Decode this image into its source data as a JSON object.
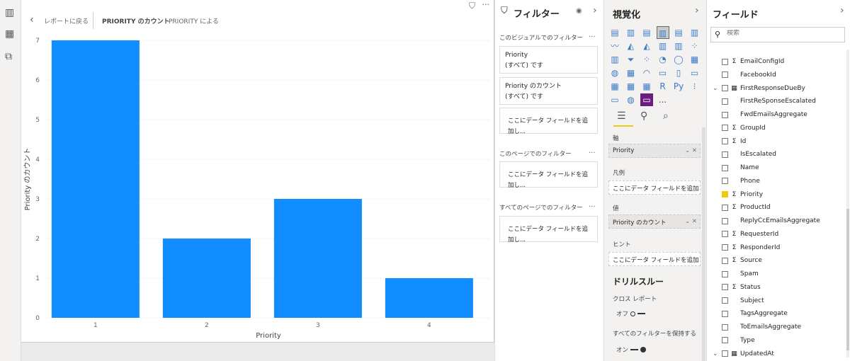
{
  "nav": {
    "icons": [
      "report-icon",
      "data-icon",
      "model-icon"
    ]
  },
  "header": {
    "back": "レポートに戻る",
    "tab1": "PRIORITY のカウント",
    "tab2": "PRIORITY による"
  },
  "chart_data": {
    "type": "bar",
    "categories": [
      "1",
      "2",
      "3",
      "4"
    ],
    "values": [
      7,
      2,
      3,
      1
    ],
    "xlabel": "Priority",
    "ylabel": "Priority のカウント",
    "ylim": [
      0,
      7
    ],
    "yticks": [
      0,
      1,
      2,
      3,
      4,
      5,
      6,
      7
    ],
    "color": "#118dff",
    "grid": true
  },
  "filters": {
    "title": "フィルター",
    "visual_section": "このビジュアルでのフィルター",
    "cards": [
      {
        "name": "Priority",
        "value": "(すべて) です"
      },
      {
        "name": "Priority のカウント",
        "value": "(すべて) です"
      }
    ],
    "add": "ここにデータ フィールドを追加し...",
    "page_section": "このページでのフィルター",
    "all_section": "すべてのページでのフィルター",
    "more": "..."
  },
  "viz": {
    "title": "視覚化",
    "axis_label": "軸",
    "axis_value": "Priority",
    "legend_label": "凡例",
    "add": "ここにデータ フィールドを追加して...",
    "values_label": "値",
    "values_value": "Priority のカウント",
    "tooltip_label": "ヒント",
    "drill_title": "ドリルスルー",
    "cross_report": "クロス レポート",
    "off": "オフ",
    "keep_filters": "すべてのフィルターを保持する",
    "on": "オン",
    "more": "..."
  },
  "fields": {
    "title": "フィールド",
    "search_placeholder": "検索",
    "items": [
      {
        "name": "EmailConfigId",
        "sigma": true
      },
      {
        "name": "FacebookId",
        "sigma": false
      },
      {
        "name": "FirstResponseDueBy",
        "table": true
      },
      {
        "name": "FirstReSponseEscalated",
        "sigma": false
      },
      {
        "name": "FwdEmailsAggregate",
        "sigma": false
      },
      {
        "name": "GroupId",
        "sigma": true
      },
      {
        "name": "Id",
        "sigma": true
      },
      {
        "name": "IsEscalated",
        "sigma": false
      },
      {
        "name": "Name",
        "sigma": false
      },
      {
        "name": "Phone",
        "sigma": false
      },
      {
        "name": "Priority",
        "sigma": true,
        "checked": true
      },
      {
        "name": "ProductId",
        "sigma": true
      },
      {
        "name": "ReplyCcEmailsAggregate",
        "sigma": false
      },
      {
        "name": "RequesterId",
        "sigma": true
      },
      {
        "name": "ResponderId",
        "sigma": true
      },
      {
        "name": "Source",
        "sigma": true
      },
      {
        "name": "Spam",
        "sigma": false
      },
      {
        "name": "Status",
        "sigma": true
      },
      {
        "name": "Subject",
        "sigma": false
      },
      {
        "name": "TagsAggregate",
        "sigma": false
      },
      {
        "name": "ToEmailsAggregate",
        "sigma": false
      },
      {
        "name": "Type",
        "sigma": false
      },
      {
        "name": "UpdatedAt",
        "table": true
      }
    ]
  }
}
